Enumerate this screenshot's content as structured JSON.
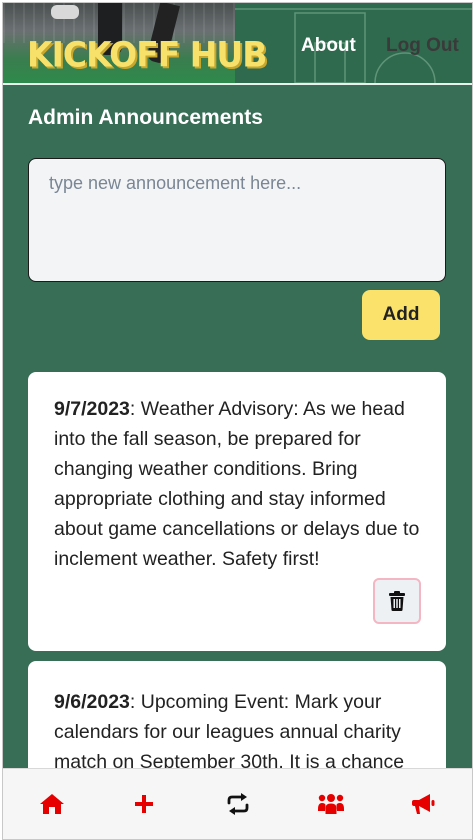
{
  "header": {
    "logo_text": "KICKOFF HUB",
    "nav": {
      "about_label": "About",
      "logout_label": "Log Out"
    }
  },
  "main": {
    "section_title": "Admin Announcements",
    "input_placeholder": "type new announcement here...",
    "input_value": "",
    "add_label": "Add",
    "announcements": [
      {
        "date": "9/7/2023",
        "text": ": Weather Advisory: As we head into the fall season, be prepared for changing weather conditions. Bring appropriate clothing and stay informed about game cancellations or delays due to inclement weather. Safety first!"
      },
      {
        "date": "9/6/2023",
        "text": ": Upcoming Event: Mark your calendars for our leagues annual charity match on September 30th. It is a chance"
      }
    ]
  },
  "bottom_nav": {
    "items": [
      {
        "icon": "home-icon"
      },
      {
        "icon": "plus-icon"
      },
      {
        "icon": "swap-icon"
      },
      {
        "icon": "users-icon"
      },
      {
        "icon": "megaphone-icon"
      }
    ],
    "icon_color": "#e60000"
  },
  "colors": {
    "background": "#386e56",
    "logo": "#f8e16a",
    "add_button": "#fbe26b",
    "card": "#ffffff"
  }
}
